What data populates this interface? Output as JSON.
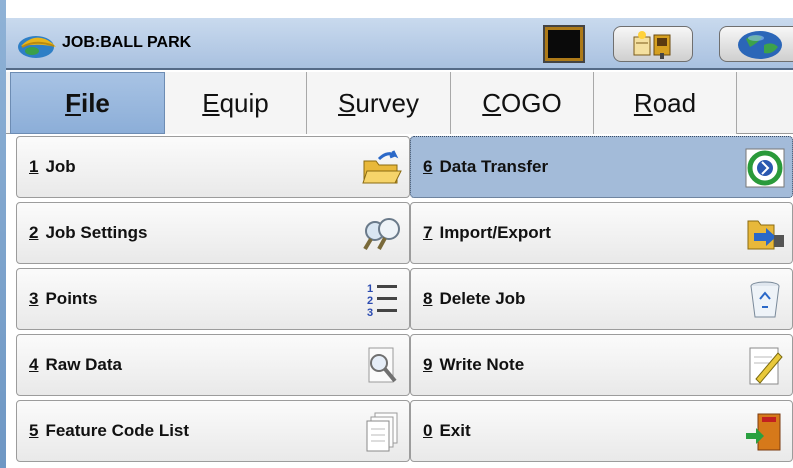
{
  "title_bar": {
    "job_title": "JOB:BALL PARK",
    "icons": [
      "hardhat-logo-icon",
      "battery-icon",
      "instrument-icon",
      "globe-icon"
    ]
  },
  "tabs": [
    {
      "pre": "",
      "accel": "F",
      "post": "ile",
      "active": true
    },
    {
      "pre": "",
      "accel": "E",
      "post": "quip",
      "active": false
    },
    {
      "pre": "",
      "accel": "S",
      "post": "urvey",
      "active": false
    },
    {
      "pre": "",
      "accel": "C",
      "post": "OGO",
      "active": false
    },
    {
      "pre": "",
      "accel": "R",
      "post": "oad",
      "active": false
    }
  ],
  "menu": [
    {
      "num": "1",
      "label": "Job",
      "icon": "open-folder-icon"
    },
    {
      "num": "2",
      "label": "Job Settings",
      "icon": "magnifier-settings-icon"
    },
    {
      "num": "3",
      "label": "Points",
      "icon": "numbered-list-icon"
    },
    {
      "num": "4",
      "label": "Raw Data",
      "icon": "search-document-icon"
    },
    {
      "num": "5",
      "label": "Feature Code List",
      "icon": "document-stack-icon"
    },
    {
      "num": "6",
      "label": "Data Transfer",
      "icon": "data-transfer-icon",
      "selected": true
    },
    {
      "num": "7",
      "label": "Import/Export",
      "icon": "import-export-icon"
    },
    {
      "num": "8",
      "label": "Delete Job",
      "icon": "recycle-bin-icon"
    },
    {
      "num": "9",
      "label": "Write Note",
      "icon": "write-note-icon"
    },
    {
      "num": "0",
      "label": "Exit",
      "icon": "exit-door-icon"
    }
  ],
  "colors": {
    "selected": "#a3bbd9",
    "titlebar": "#b7cbe6",
    "active_tab": "#9ab8de"
  }
}
